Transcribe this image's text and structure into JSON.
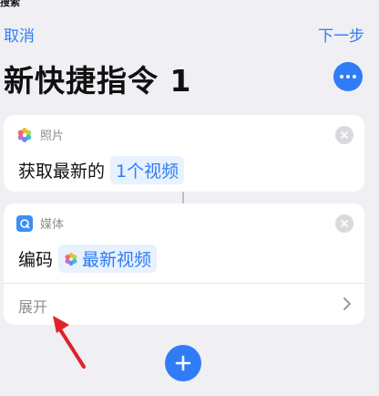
{
  "status_bar": {
    "text": "搜索"
  },
  "nav": {
    "cancel": "取消",
    "next": "下一步"
  },
  "title": "新快捷指令 1",
  "cards": [
    {
      "app_label": "照片",
      "icon": "photos-icon",
      "action": "获取最新的",
      "token": "1个视频"
    },
    {
      "app_label": "媒体",
      "icon": "media-icon",
      "action": "编码",
      "token": "最新视频",
      "expand_label": "展开"
    }
  ],
  "colors": {
    "accent": "#2f7cf6",
    "annotation_arrow": "#e0222a"
  }
}
